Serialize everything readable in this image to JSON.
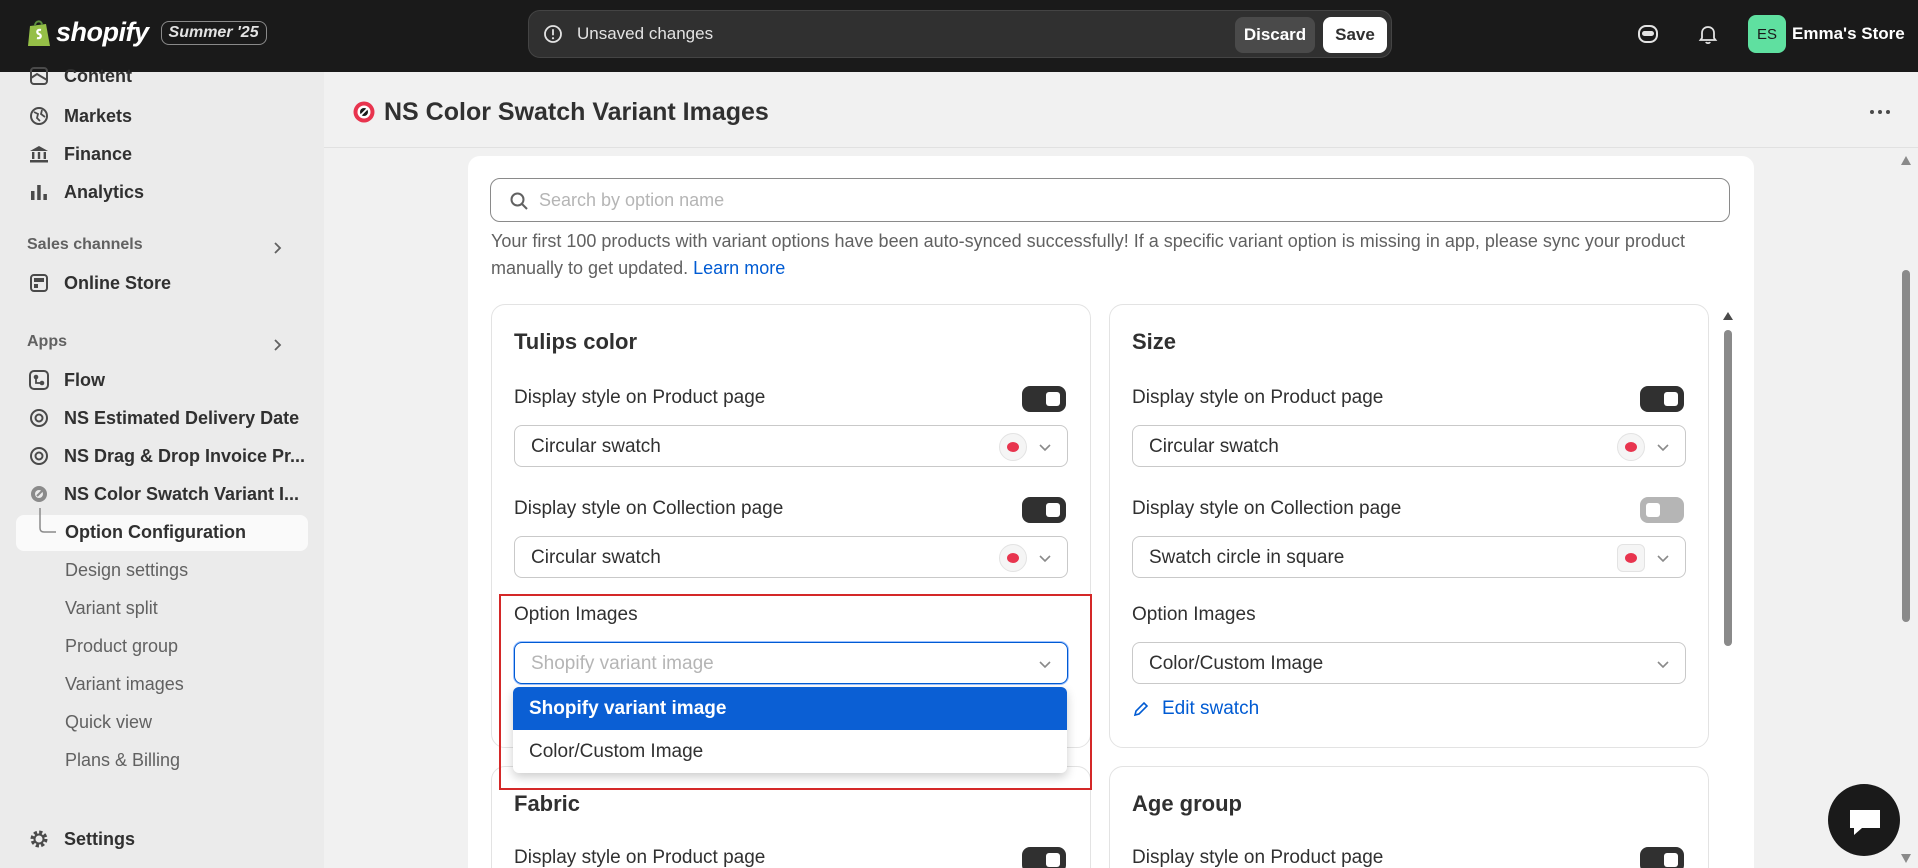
{
  "topbar": {
    "logo_text": "shopify",
    "edition": "Summer '25",
    "unsaved_message": "Unsaved changes",
    "discard_label": "Discard",
    "save_label": "Save",
    "avatar_initials": "ES",
    "store_name": "Emma's Store"
  },
  "sidebar": {
    "items_top": [
      {
        "label": "Content",
        "icon": "content-icon"
      },
      {
        "label": "Markets",
        "icon": "globe-icon"
      },
      {
        "label": "Finance",
        "icon": "bank-icon"
      },
      {
        "label": "Analytics",
        "icon": "bar-chart-icon"
      }
    ],
    "sales_channels_title": "Sales channels",
    "online_store_label": "Online Store",
    "apps_title": "Apps",
    "apps": [
      {
        "label": "Flow",
        "icon": "flow-icon"
      },
      {
        "label": "NS Estimated Delivery Date",
        "icon": "app-icon"
      },
      {
        "label": "NS Drag & Drop Invoice Pr...",
        "icon": "app-icon"
      },
      {
        "label": "NS Color Swatch Variant I...",
        "icon": "swatch-app-icon"
      }
    ],
    "sub_items": [
      {
        "label": "Option Configuration",
        "active": true
      },
      {
        "label": "Design settings"
      },
      {
        "label": "Variant split"
      },
      {
        "label": "Product group"
      },
      {
        "label": "Variant images"
      },
      {
        "label": "Quick view"
      },
      {
        "label": "Plans & Billing"
      }
    ],
    "settings_label": "Settings"
  },
  "page": {
    "title": "NS Color Swatch Variant Images",
    "search_placeholder": "Search by option name",
    "notice_text": "Your first 100 products with variant options have been auto-synced successfully! If a specific variant option is missing in app, please sync your product manually to get updated.",
    "learn_more": "Learn more"
  },
  "options": {
    "tulips": {
      "title": "Tulips color",
      "product_label": "Display style on Product page",
      "product_value": "Circular swatch",
      "collection_label": "Display style on Collection page",
      "collection_value": "Circular swatch",
      "images_label": "Option Images",
      "images_placeholder": "Shopify variant image"
    },
    "size": {
      "title": "Size",
      "product_label": "Display style on Product page",
      "product_value": "Circular swatch",
      "collection_label": "Display style on Collection page",
      "collection_value": "Swatch circle in square",
      "images_label": "Option Images",
      "images_value": "Color/Custom Image",
      "edit_swatch": "Edit swatch"
    },
    "fabric": {
      "title": "Fabric",
      "product_label": "Display style on Product page"
    },
    "age_group": {
      "title": "Age group",
      "product_label": "Display style on Product page"
    }
  },
  "dropdown": {
    "options": [
      "Shopify variant image",
      "Color/Custom Image"
    ],
    "selected_index": 0
  },
  "colors": {
    "accent": "#005bd3",
    "selected_option": "#0b5fd4",
    "highlight_border": "#d42828",
    "swatch": "#e8344e"
  }
}
